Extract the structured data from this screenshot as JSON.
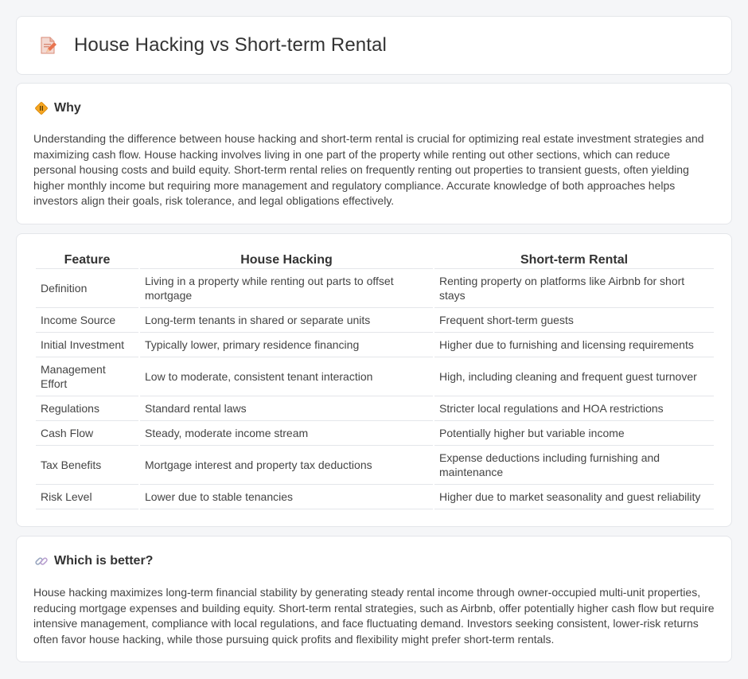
{
  "page": {
    "title": "House Hacking vs Short-term Rental",
    "title_icon": "document-pencil-icon"
  },
  "why": {
    "heading": "Why",
    "icon": "diamond-sign-icon",
    "text": "Understanding the difference between house hacking and short-term rental is crucial for optimizing real estate investment strategies and maximizing cash flow. House hacking involves living in one part of the property while renting out other sections, which can reduce personal housing costs and build equity. Short-term rental relies on frequently renting out properties to transient guests, often yielding higher monthly income but requiring more management and regulatory compliance. Accurate knowledge of both approaches helps investors align their goals, risk tolerance, and legal obligations effectively."
  },
  "comparison": {
    "headers": [
      "Feature",
      "House Hacking",
      "Short-term Rental"
    ],
    "rows": [
      {
        "feature": "Definition",
        "house_hacking": "Living in a property while renting out parts to offset mortgage",
        "short_term": "Renting property on platforms like Airbnb for short stays"
      },
      {
        "feature": "Income Source",
        "house_hacking": "Long-term tenants in shared or separate units",
        "short_term": "Frequent short-term guests"
      },
      {
        "feature": "Initial Investment",
        "house_hacking": "Typically lower, primary residence financing",
        "short_term": "Higher due to furnishing and licensing requirements"
      },
      {
        "feature": "Management Effort",
        "house_hacking": "Low to moderate, consistent tenant interaction",
        "short_term": "High, including cleaning and frequent guest turnover"
      },
      {
        "feature": "Regulations",
        "house_hacking": "Standard rental laws",
        "short_term": "Stricter local regulations and HOA restrictions"
      },
      {
        "feature": "Cash Flow",
        "house_hacking": "Steady, moderate income stream",
        "short_term": "Potentially higher but variable income"
      },
      {
        "feature": "Tax Benefits",
        "house_hacking": "Mortgage interest and property tax deductions",
        "short_term": "Expense deductions including furnishing and maintenance"
      },
      {
        "feature": "Risk Level",
        "house_hacking": "Lower due to stable tenancies",
        "short_term": "Higher due to market seasonality and guest reliability"
      }
    ]
  },
  "better": {
    "heading": "Which is better?",
    "icon": "link-icon",
    "text": "House hacking maximizes long-term financial stability by generating steady rental income through owner-occupied multi-unit properties, reducing mortgage expenses and building equity. Short-term rental strategies, such as Airbnb, offer potentially higher cash flow but require intensive management, compliance with local regulations, and face fluctuating demand. Investors seeking consistent, lower-risk returns often favor house hacking, while those pursuing quick profits and flexibility might prefer short-term rentals."
  }
}
